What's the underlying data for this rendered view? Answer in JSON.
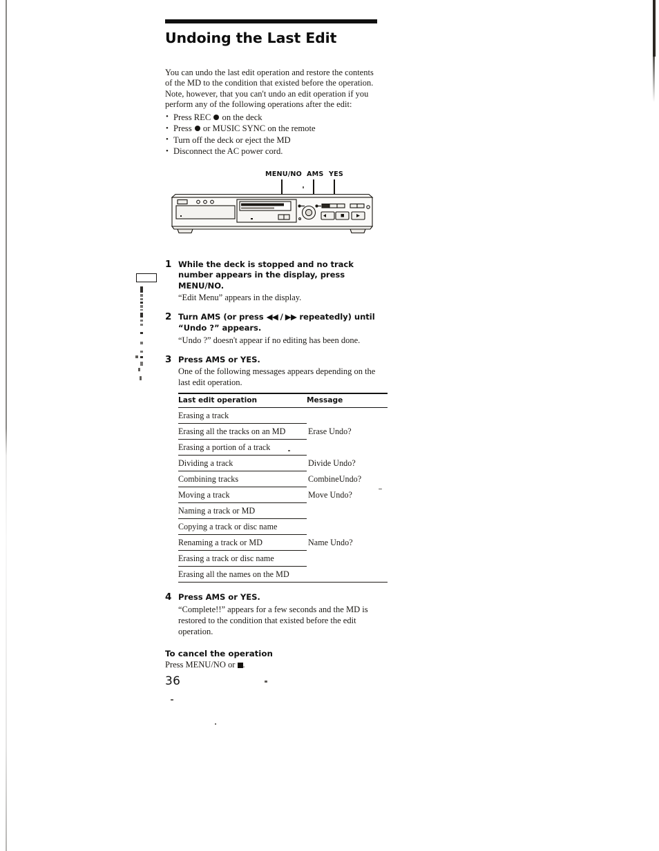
{
  "page": {
    "number": "36",
    "title": "Undoing the Last Edit"
  },
  "intro": {
    "paragraph": "You can undo the last edit operation and restore the contents of the MD to the condition that existed before the operation.  Note, however, that you can't undo an edit operation if you perform any of the following operations after the edit:",
    "bullets": [
      {
        "before": "Press REC ",
        "dot": true,
        "after": " on the deck"
      },
      {
        "before": "Press ",
        "dot": true,
        "after": " or MUSIC SYNC on the remote"
      },
      {
        "before": "Turn off the deck or eject the MD",
        "dot": false,
        "after": ""
      },
      {
        "before": "Disconnect the AC power cord.",
        "dot": false,
        "after": ""
      }
    ]
  },
  "figure": {
    "alt": "md-deck-front-panel",
    "callouts": [
      {
        "label": "MENU/NO",
        "name": "callout-menu-no"
      },
      {
        "label": "AMS",
        "name": "callout-ams"
      },
      {
        "label": "YES",
        "name": "callout-yes"
      }
    ]
  },
  "steps": [
    {
      "num": "1",
      "heading": "While the deck is stopped and no track number appears in the display, press MENU/NO.",
      "body": "“Edit Menu” appears in the display."
    },
    {
      "num": "2",
      "heading_pre": "Turn AMS (or press ",
      "heading_sym": "◀◀ / ▶▶",
      "heading_post": " repeatedly) until “Undo ?” appears.",
      "heading": "Turn AMS (or press ⏮/⏭ repeatedly) until “Undo ?” appears.",
      "body": "“Undo ?” doesn't appear if no editing has been done."
    },
    {
      "num": "3",
      "heading": "Press AMS or YES.",
      "body": "One of the following messages appears depending on the last edit operation."
    },
    {
      "num": "4",
      "heading": "Press AMS or YES.",
      "body": "“Complete!!” appears for a few seconds and the MD is restored to the condition that existed before the edit operation."
    }
  ],
  "message_table": {
    "headers": [
      "Last edit operation",
      "Message"
    ],
    "rows": [
      {
        "operation": "Erasing a track",
        "message": ""
      },
      {
        "operation": "Erasing all the tracks on an MD",
        "message": "Erase Undo?"
      },
      {
        "operation": "Erasing a portion of a track",
        "message": ""
      },
      {
        "operation": "Dividing a track",
        "message": "Divide Undo?"
      },
      {
        "operation": "Combining tracks",
        "message": "CombineUndo?"
      },
      {
        "operation": "Moving a track",
        "message": "Move Undo?"
      },
      {
        "operation": "Naming a track or MD",
        "message": ""
      },
      {
        "operation": "Copying a track or disc name",
        "message": ""
      },
      {
        "operation": "Renaming a track or MD",
        "message": "Name Undo?"
      },
      {
        "operation": "Erasing a track or disc name",
        "message": ""
      },
      {
        "operation": "Erasing all the names on the MD",
        "message": ""
      }
    ]
  },
  "closing": {
    "heading": "To cancel the operation",
    "body_pre": "Press MENU/NO or ",
    "body_post": "."
  }
}
